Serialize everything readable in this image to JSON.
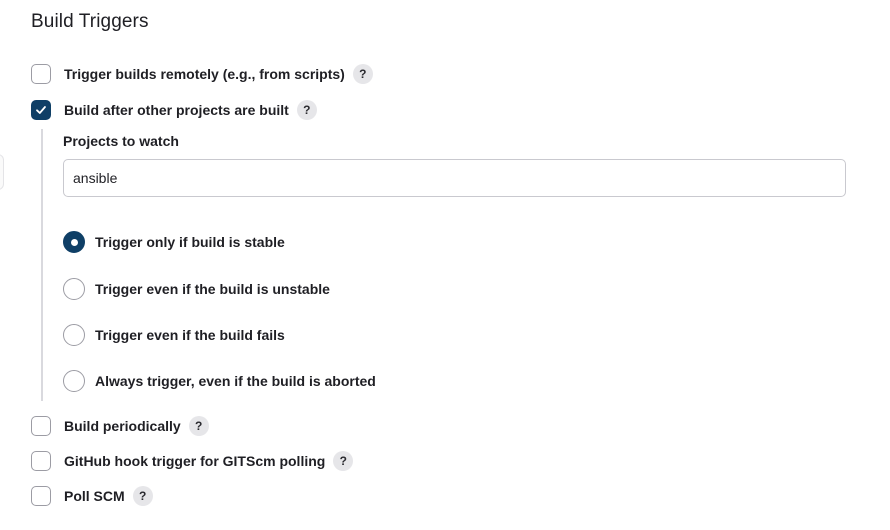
{
  "section": {
    "title": "Build Triggers"
  },
  "triggers": {
    "remote": {
      "label": "Trigger builds remotely (e.g., from scripts)",
      "checked": false,
      "help": "?"
    },
    "after_other": {
      "label": "Build after other projects are built",
      "checked": true,
      "help": "?"
    },
    "periodically": {
      "label": "Build periodically",
      "checked": false,
      "help": "?"
    },
    "github_hook": {
      "label": "GitHub hook trigger for GITScm polling",
      "checked": false,
      "help": "?"
    },
    "poll_scm": {
      "label": "Poll SCM",
      "checked": false,
      "help": "?"
    }
  },
  "projects_to_watch": {
    "label": "Projects to watch",
    "value": "ansible"
  },
  "trigger_conditions": {
    "selected_index": 0,
    "options": [
      "Trigger only if build is stable",
      "Trigger even if the build is unstable",
      "Trigger even if the build fails",
      "Always trigger, even if the build is aborted"
    ]
  },
  "colors": {
    "accent": "#0f3f66",
    "border": "#9c9ca4",
    "help_bg": "#e6e6e9"
  },
  "icons": {
    "checkmark": "check-icon",
    "help": "help-icon"
  }
}
